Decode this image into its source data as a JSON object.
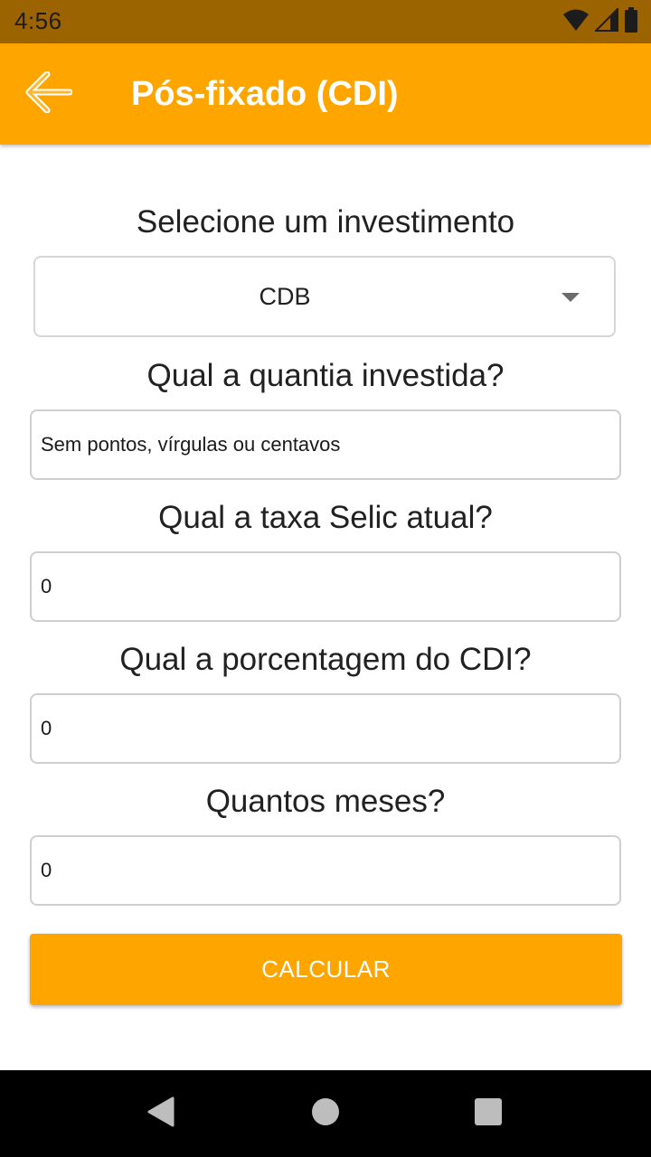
{
  "status_bar": {
    "time": "4:56",
    "icons": [
      "wifi-icon",
      "cell-signal-icon",
      "battery-icon"
    ]
  },
  "app_bar": {
    "title": "Pós-fixado (CDI)",
    "back_icon": "arrow-left-icon",
    "color": "#ffa500"
  },
  "form": {
    "investment_label": "Selecione um investimento",
    "investment_selected": "CDB",
    "amount_label": "Qual a quantia investida?",
    "amount_placeholder": "Sem pontos, vírgulas ou centavos",
    "amount_value": "",
    "selic_label": "Qual a taxa Selic atual?",
    "selic_value": "0",
    "cdi_label": "Qual a porcentagem do CDI?",
    "cdi_value": "0",
    "months_label": "Quantos meses?",
    "months_value": "0",
    "calculate_label": "CALCULAR"
  },
  "nav_bar": {
    "icons": [
      "back-triangle-icon",
      "home-circle-icon",
      "recents-square-icon"
    ]
  },
  "colors": {
    "accent": "#ffa500",
    "status_bar": "#9c6400",
    "text": "#212121"
  }
}
